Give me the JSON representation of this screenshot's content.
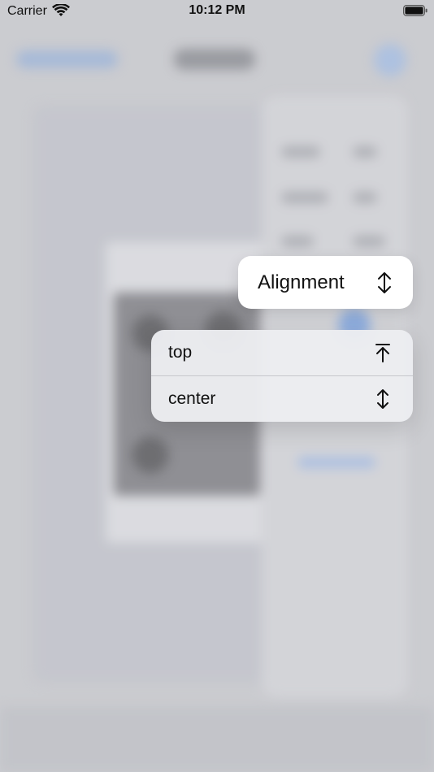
{
  "status_bar": {
    "carrier": "Carrier",
    "time": "10:12 PM",
    "wifi_icon": "wifi-icon",
    "battery_icon": "battery-icon"
  },
  "alignment_button": {
    "label": "Alignment",
    "icon": "up-down-arrows-icon"
  },
  "menu": {
    "items": [
      {
        "label": "top",
        "icon": "arrow-up-to-line-icon"
      },
      {
        "label": "center",
        "icon": "up-down-arrows-icon"
      }
    ]
  },
  "colors": {
    "background": "#cfd0d3",
    "menu_background": "#ecedf0",
    "button_background": "#ffffff",
    "accent_blurred": "#7fa8e6"
  }
}
